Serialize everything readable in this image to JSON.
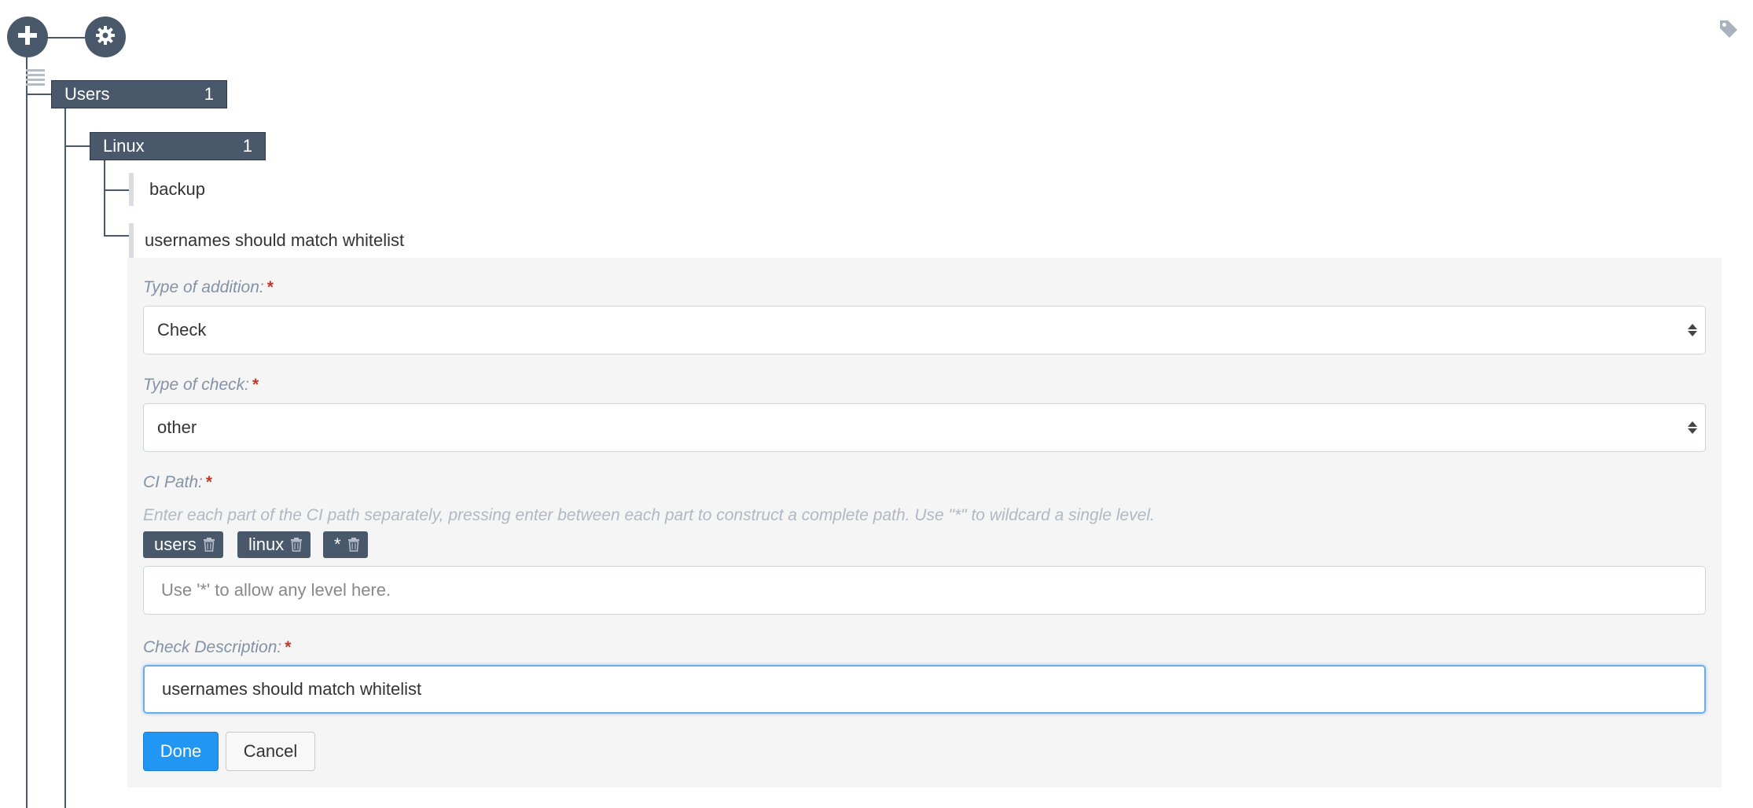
{
  "toolbar": {
    "add_icon": "plus-icon",
    "settings_icon": "gear-icon",
    "tag_icon": "tag-icon"
  },
  "tree": {
    "list_icon": "list-icon",
    "root": {
      "label": "Users",
      "count": "1"
    },
    "child": {
      "label": "Linux",
      "count": "1"
    },
    "leaves": [
      {
        "label": "backup"
      },
      {
        "label": "usernames should match whitelist"
      }
    ]
  },
  "form": {
    "addition": {
      "label": "Type of addition:",
      "required": "*",
      "value": "Check"
    },
    "check_type": {
      "label": "Type of check:",
      "required": "*",
      "value": "other"
    },
    "ci_path": {
      "label": "CI Path:",
      "required": "*",
      "hint": "Enter each part of the CI path separately, pressing enter between each part to construct a complete path. Use \"*\" to wildcard a single level.",
      "tags": [
        {
          "text": "users"
        },
        {
          "text": "linux"
        },
        {
          "text": "*"
        }
      ],
      "placeholder": "Use '*' to allow any level here."
    },
    "description": {
      "label": "Check Description:",
      "required": "*",
      "value": "usernames should match whitelist"
    },
    "done_label": "Done",
    "cancel_label": "Cancel"
  },
  "colors": {
    "node": "#4a586c",
    "primary": "#2196f3",
    "panel": "#f5f5f5"
  }
}
